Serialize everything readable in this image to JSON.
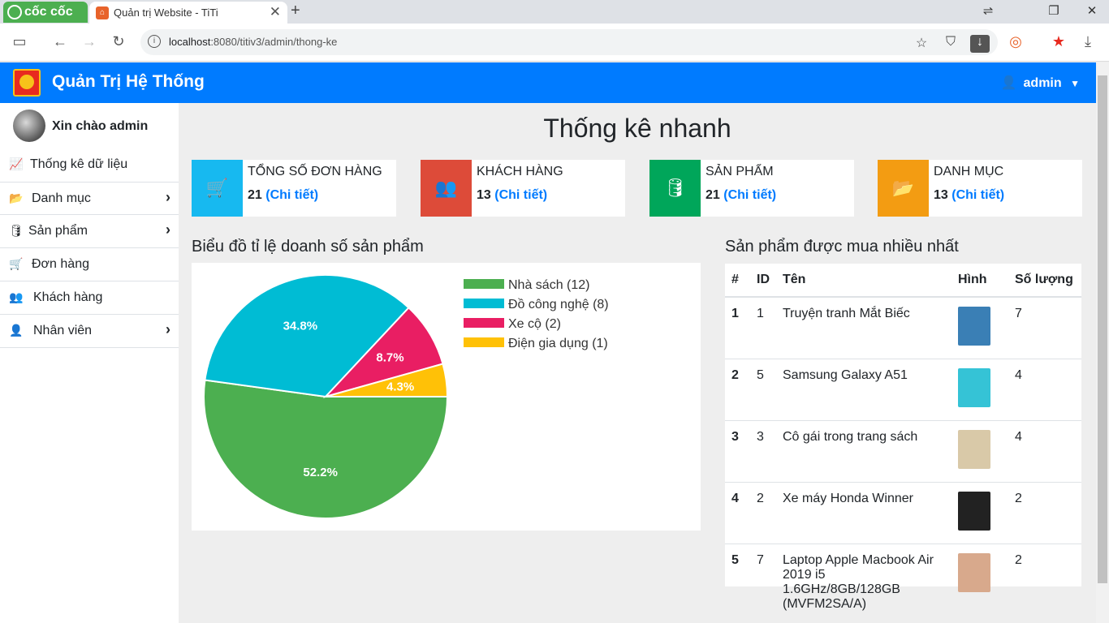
{
  "browser": {
    "brand": "cốc cốc",
    "tab_title": "Quản trị Website - TiTi",
    "url_host": "localhost",
    "url_rest": ":8080/titiv3/admin/thong-ke"
  },
  "header": {
    "title": "Quản Trị Hệ Thống",
    "user": "admin"
  },
  "sidebar": {
    "greeting": "Xin chào admin",
    "items": [
      {
        "label": "Thống kê dữ liệu",
        "icon": "chart-line-icon",
        "sub": false
      },
      {
        "label": "Danh mục",
        "icon": "folder-open-icon",
        "sub": true
      },
      {
        "label": "Sản phẩm",
        "icon": "database-icon",
        "sub": true
      },
      {
        "label": "Đơn hàng",
        "icon": "cart-icon",
        "sub": false
      },
      {
        "label": "Khách hàng",
        "icon": "users-icon",
        "sub": false
      },
      {
        "label": "Nhân viên",
        "icon": "user-tie-icon",
        "sub": true
      }
    ]
  },
  "main": {
    "title": "Thống kê nhanh",
    "cards": [
      {
        "title": "TỔNG SỐ ĐƠN HÀNG",
        "count": "21",
        "link": "(Chi tiết)",
        "color": "#17b9f0",
        "icon": "cart-plus-icon"
      },
      {
        "title": "KHÁCH HÀNG",
        "count": "13",
        "link": "(Chi tiết)",
        "color": "#dd4b39",
        "icon": "users-icon"
      },
      {
        "title": "SẢN PHẨM",
        "count": "21",
        "link": "(Chi tiết)",
        "color": "#00a65a",
        "icon": "database-icon"
      },
      {
        "title": "DANH MỤC",
        "count": "13",
        "link": "(Chi tiết)",
        "color": "#f39c12",
        "icon": "folder-open-icon"
      }
    ],
    "chart_title": "Biểu đồ tỉ lệ doanh số sản phẩm",
    "table_title": "Sản phẩm được mua nhiều nhất",
    "table": {
      "headers": [
        "#",
        "ID",
        "Tên",
        "Hình",
        "Số lượng"
      ],
      "rows": [
        {
          "n": "1",
          "id": "1",
          "name": "Truyện tranh Mắt Biếc",
          "qty": "7",
          "img": "#3a7fb5"
        },
        {
          "n": "2",
          "id": "5",
          "name": "Samsung Galaxy A51",
          "qty": "4",
          "img": "#35c3d6"
        },
        {
          "n": "3",
          "id": "3",
          "name": "Cô gái trong trang sách",
          "qty": "4",
          "img": "#d9c9a8"
        },
        {
          "n": "4",
          "id": "2",
          "name": "Xe máy Honda Winner",
          "qty": "2",
          "img": "#222222"
        },
        {
          "n": "5",
          "id": "7",
          "name": "Laptop Apple Macbook Air 2019 i5 1.6GHz/8GB/128GB (MVFM2SA/A)",
          "qty": "2",
          "img": "#d8a98c"
        }
      ]
    }
  },
  "chart_data": {
    "type": "pie",
    "categories": [
      "Nhà sách",
      "Đồ công nghệ",
      "Xe cộ",
      "Điện gia dụng"
    ],
    "legend_labels": [
      "Nhà sách (12)",
      "Đồ công nghệ (8)",
      "Xe cộ (2)",
      "Điện gia dụng (1)"
    ],
    "values": [
      12,
      8,
      2,
      1
    ],
    "percent_labels": [
      "52.2%",
      "34.8%",
      "8.7%",
      "4.3%"
    ],
    "colors": [
      "#4caf50",
      "#00bcd4",
      "#e91e63",
      "#ffc107"
    ],
    "legend_position": "top-right"
  }
}
